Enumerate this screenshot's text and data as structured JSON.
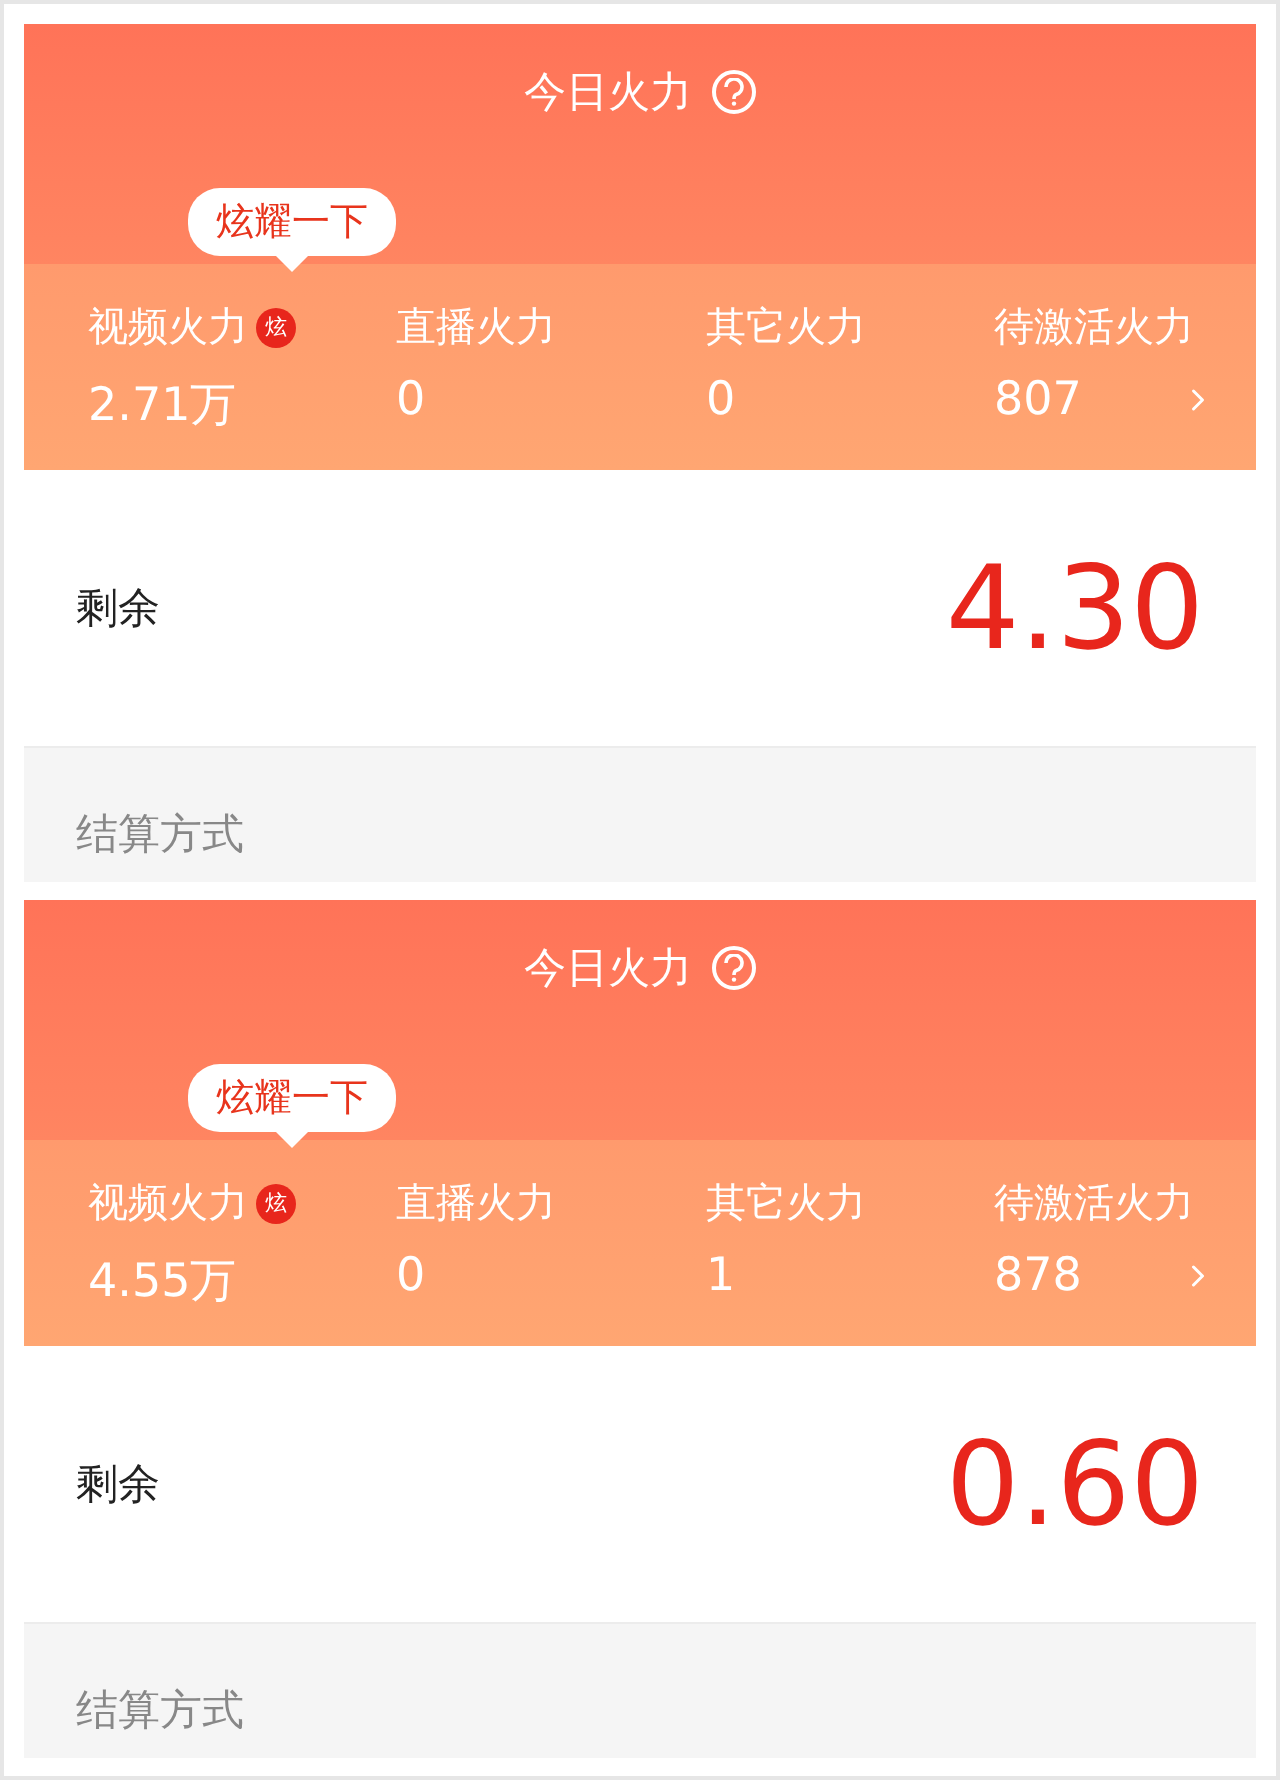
{
  "panels": [
    {
      "title": "今日火力",
      "tooltip": "炫耀一下",
      "stats": [
        {
          "label": "视频火力",
          "badge": "炫",
          "value": "2.71万"
        },
        {
          "label": "直播火力",
          "value": "0"
        },
        {
          "label": "其它火力",
          "value": "0"
        },
        {
          "label": "待激活火力",
          "value": "807",
          "chevron": true
        }
      ],
      "remaining_label": "剩余",
      "remaining_value": "4.30",
      "settlement_label": "结算方式"
    },
    {
      "title": "今日火力",
      "tooltip": "炫耀一下",
      "stats": [
        {
          "label": "视频火力",
          "badge": "炫",
          "value": "4.55万"
        },
        {
          "label": "直播火力",
          "value": "0"
        },
        {
          "label": "其它火力",
          "value": "1"
        },
        {
          "label": "待激活火力",
          "value": "878",
          "chevron": true
        }
      ],
      "remaining_label": "剩余",
      "remaining_value": "0.60",
      "settlement_label": "结算方式"
    }
  ]
}
